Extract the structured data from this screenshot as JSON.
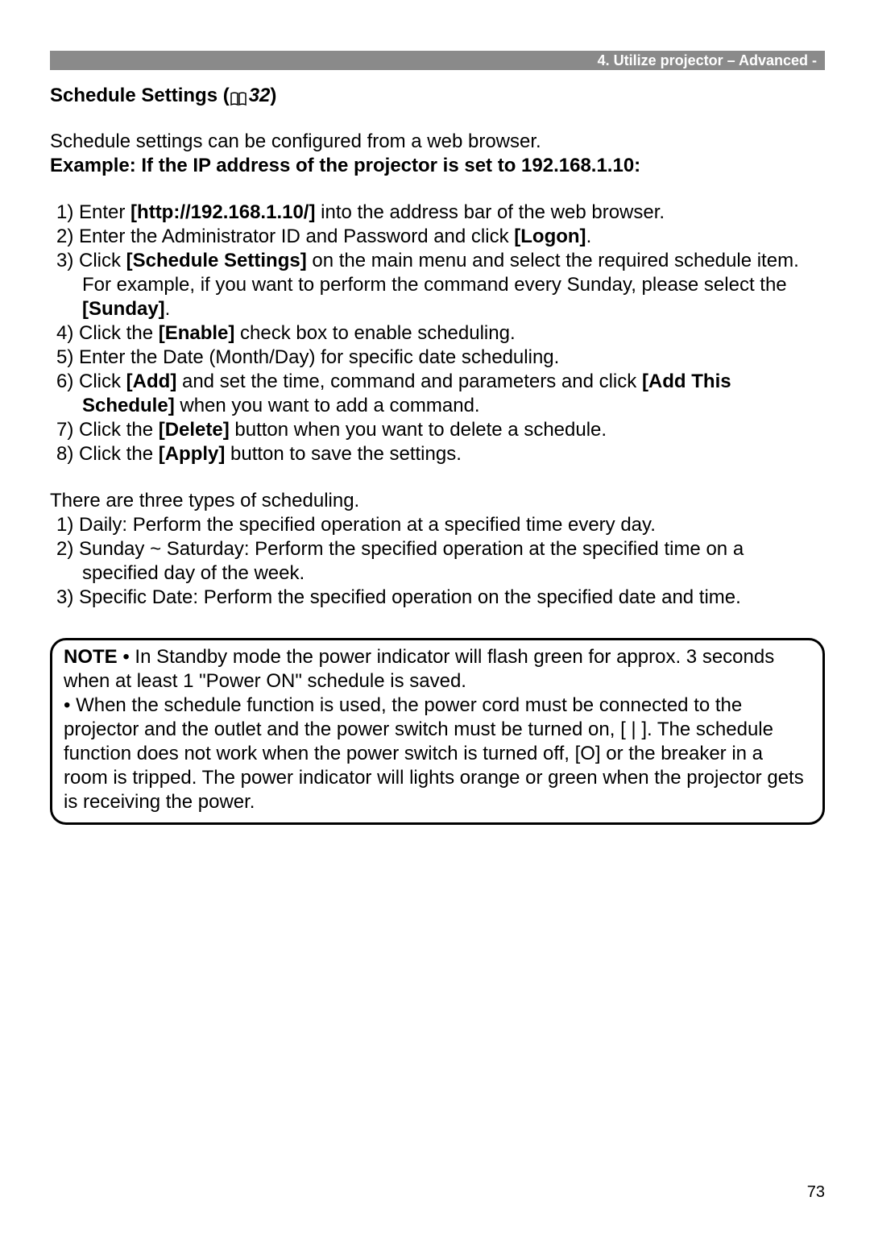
{
  "header": {
    "breadcrumb": "4. Utilize projector – Advanced -"
  },
  "section": {
    "title_prefix": "Schedule Settings (",
    "title_ref": "32",
    "title_suffix": ")"
  },
  "intro": {
    "line1": "Schedule settings can be configured from a web browser.",
    "example": "Example: If the IP address of the projector is set to 192.168.1.10:"
  },
  "steps": {
    "s1p1": "1) Enter ",
    "s1b1": "[http://192.168.1.10/]",
    "s1p2": " into the address bar of the web browser.",
    "s2p1": "2) Enter the Administrator ID and Password and click ",
    "s2b1": "[Logon]",
    "s2p2": ".",
    "s3p1": "3) Click ",
    "s3b1": "[Schedule Settings]",
    "s3p2": " on the main menu and select the required schedule item. For example, if you want to perform the command every Sunday, please select the ",
    "s3b2": "[Sunday]",
    "s3p3": ".",
    "s4p1": "4) Click the ",
    "s4b1": "[Enable]",
    "s4p2": " check box to enable scheduling.",
    "s5p1": "5) Enter the Date (Month/Day) for specific date scheduling.",
    "s6p1": "6) Click ",
    "s6b1": "[Add]",
    "s6p2": " and set the time, command and parameters and click ",
    "s6b2": "[Add This Schedule]",
    "s6p3": " when you want to add a command.",
    "s7p1": "7) Click the ",
    "s7b1": "[Delete]",
    "s7p2": " button when you want to delete a schedule.",
    "s8p1": "8) Click the ",
    "s8b1": "[Apply]",
    "s8p2": " button to save the settings."
  },
  "types": {
    "intro": "There are three types of scheduling.",
    "t1": "1) Daily: Perform the specified operation at a specified time every day.",
    "t2": "2) Sunday ~ Saturday: Perform the specified operation at the specified time on a specified day of the week.",
    "t3": "3) Specific Date: Perform the specified operation on the specified date and time."
  },
  "note": {
    "label": "NOTE",
    "bullet": "  • ",
    "text1": "In Standby mode the power indicator will flash green for approx. 3 seconds when at least 1 \"Power ON\" schedule is saved.",
    "text2": "• When the schedule function is used, the power cord must be connected to the projector and the outlet and the power switch must be turned on, [ | ]. The schedule function does not work when the power switch is turned off, [O] or the breaker in a room is tripped. The power indicator will lights orange or green when the projector gets is receiving the power."
  },
  "page_number": "73"
}
